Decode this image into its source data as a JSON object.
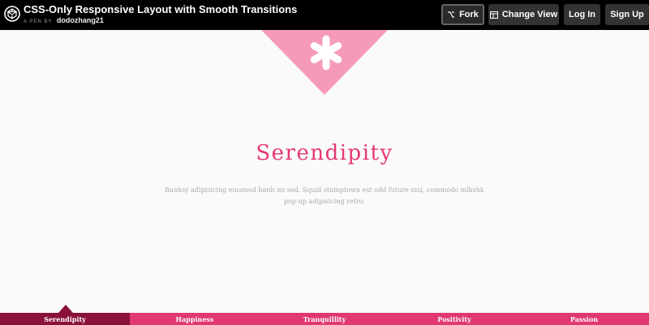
{
  "header": {
    "title": "CSS-Only Responsive Layout with Smooth Transitions",
    "pen_by": "A PEN BY",
    "author": "dodozhang21",
    "logo_icon": "codepen-logo-icon"
  },
  "toolbar": {
    "fork_label": "Fork",
    "fork_icon": "fork-icon",
    "change_view_label": "Change View",
    "change_view_icon": "layout-icon",
    "login_label": "Log In",
    "signup_label": "Sign Up"
  },
  "content": {
    "heading": "Serendipity",
    "body": "Banksy adipisicing eiusmod banh mi sed. Squid stumptown est odd future nisi, commodo mlkshk pop-up adipisicing retro.",
    "accent_color": "#e6386f",
    "triangle_color": "#f59bb9"
  },
  "nav": {
    "items": [
      {
        "label": "Serendipity",
        "active": true
      },
      {
        "label": "Happiness",
        "active": false
      },
      {
        "label": "Tranquillity",
        "active": false
      },
      {
        "label": "Positivity",
        "active": false
      },
      {
        "label": "Passion",
        "active": false
      }
    ],
    "active_color": "#8a1238",
    "bar_color": "#e0386f"
  }
}
